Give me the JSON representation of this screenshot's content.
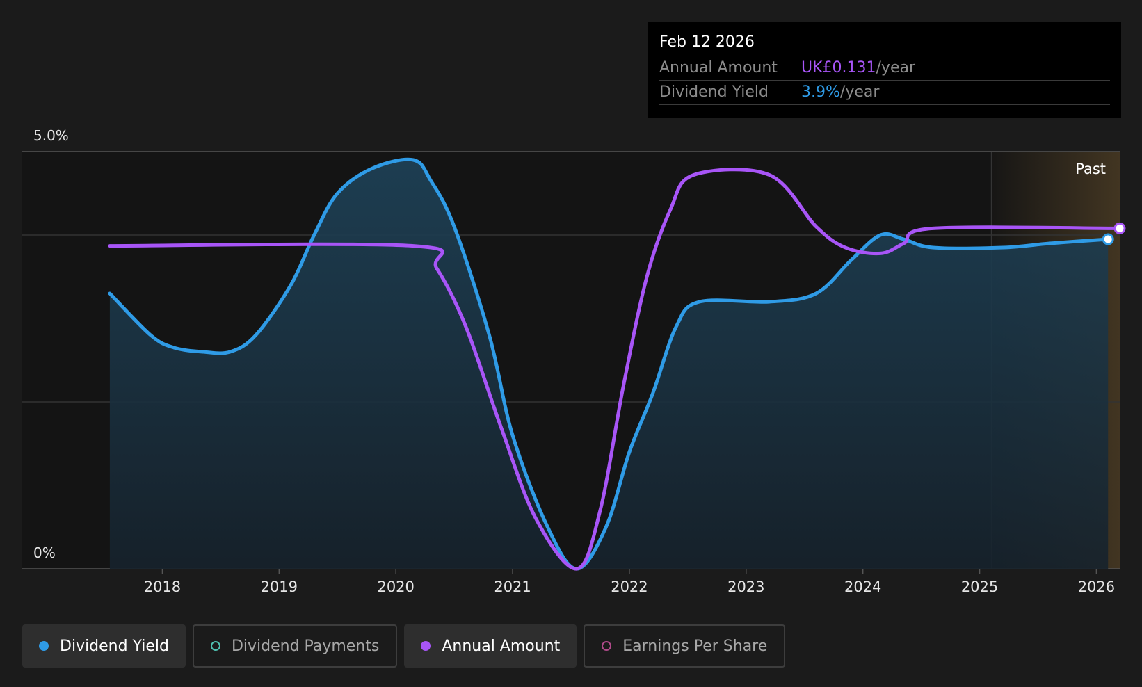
{
  "colors": {
    "dividend_yield": "#2f9be6",
    "annual_amount": "#a855f7",
    "dividend_payments": "#4fc1b0",
    "earnings_per_share": "#b04a8a",
    "background": "#1b1b1b",
    "past_region": "#4a3b24"
  },
  "tooltip": {
    "date": "Feb 12 2026",
    "annual_label": "Annual Amount",
    "annual_value": "UK£0.131",
    "annual_unit": "/year",
    "yield_label": "Dividend Yield",
    "yield_value": "3.9%",
    "yield_unit": "/year"
  },
  "legend": [
    {
      "label": "Dividend Yield",
      "active": true,
      "icon": "filled-dot"
    },
    {
      "label": "Dividend Payments",
      "active": false,
      "icon": "hollow-dot"
    },
    {
      "label": "Annual Amount",
      "active": true,
      "icon": "filled-dot"
    },
    {
      "label": "Earnings Per Share",
      "active": false,
      "icon": "hollow-dot"
    }
  ],
  "chart_data": {
    "type": "line",
    "y_labels": [
      "5.0%",
      "0%"
    ],
    "ylim": [
      0,
      5.0
    ],
    "xlim": [
      2016.8,
      2026.2
    ],
    "x_ticks": [
      "2018",
      "2019",
      "2020",
      "2021",
      "2022",
      "2023",
      "2024",
      "2025",
      "2026"
    ],
    "past_label": "Past",
    "past_start": 2025.1,
    "grid": true,
    "series": [
      {
        "name": "Dividend Yield",
        "color": "#2f9be6",
        "filled": true,
        "points": [
          [
            2017.55,
            3.3
          ],
          [
            2017.9,
            2.8
          ],
          [
            2018.1,
            2.65
          ],
          [
            2018.35,
            2.6
          ],
          [
            2018.58,
            2.6
          ],
          [
            2018.8,
            2.8
          ],
          [
            2019.1,
            3.4
          ],
          [
            2019.3,
            4.0
          ],
          [
            2019.5,
            4.5
          ],
          [
            2019.8,
            4.8
          ],
          [
            2020.15,
            4.9
          ],
          [
            2020.3,
            4.65
          ],
          [
            2020.5,
            4.1
          ],
          [
            2020.8,
            2.8
          ],
          [
            2021.0,
            1.6
          ],
          [
            2021.3,
            0.5
          ],
          [
            2021.55,
            0.0
          ],
          [
            2021.8,
            0.5
          ],
          [
            2022.0,
            1.4
          ],
          [
            2022.2,
            2.1
          ],
          [
            2022.4,
            2.9
          ],
          [
            2022.6,
            3.2
          ],
          [
            2023.2,
            3.2
          ],
          [
            2023.6,
            3.3
          ],
          [
            2023.9,
            3.7
          ],
          [
            2024.15,
            4.0
          ],
          [
            2024.35,
            3.95
          ],
          [
            2024.6,
            3.85
          ],
          [
            2025.2,
            3.85
          ],
          [
            2025.6,
            3.9
          ],
          [
            2026.1,
            3.95
          ]
        ]
      },
      {
        "name": "Annual Amount",
        "color": "#a855f7",
        "filled": false,
        "points": [
          [
            2017.55,
            3.87
          ],
          [
            2020.15,
            3.87
          ],
          [
            2020.35,
            3.6
          ],
          [
            2020.6,
            2.9
          ],
          [
            2020.9,
            1.7
          ],
          [
            2021.2,
            0.6
          ],
          [
            2021.55,
            0.0
          ],
          [
            2021.75,
            0.7
          ],
          [
            2021.95,
            2.2
          ],
          [
            2022.15,
            3.5
          ],
          [
            2022.35,
            4.3
          ],
          [
            2022.55,
            4.72
          ],
          [
            2023.2,
            4.72
          ],
          [
            2023.6,
            4.1
          ],
          [
            2023.85,
            3.85
          ],
          [
            2024.15,
            3.78
          ],
          [
            2024.35,
            3.9
          ],
          [
            2024.6,
            4.08
          ],
          [
            2026.2,
            4.08
          ]
        ]
      }
    ]
  }
}
